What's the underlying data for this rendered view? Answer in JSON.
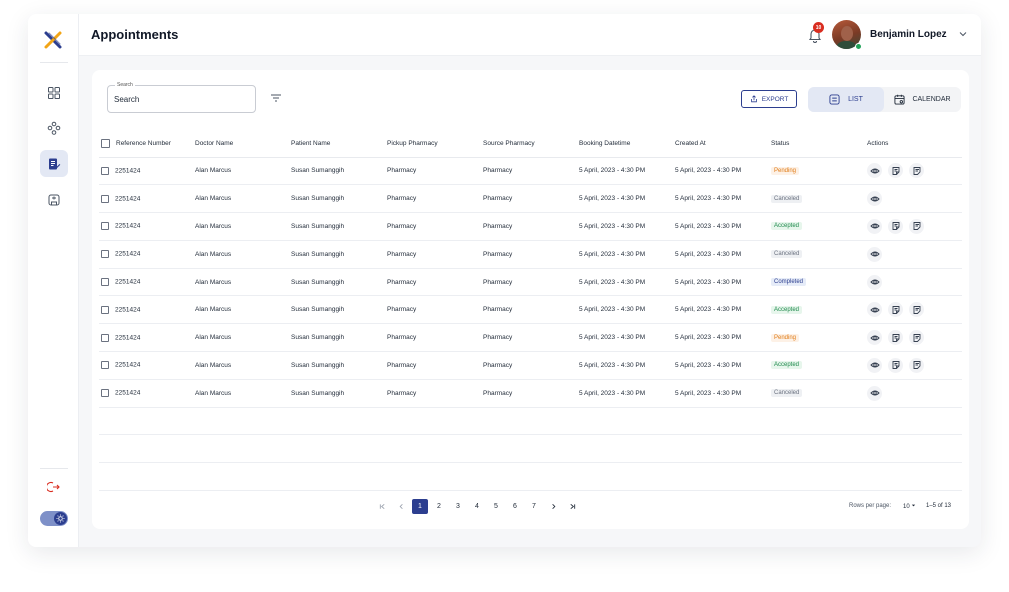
{
  "header": {
    "title": "Appointments",
    "notification_count": "10",
    "user_name": "Benjamin Lopez"
  },
  "sidebar": {
    "items": [
      {
        "icon": "dashboard-grid-icon",
        "active": false
      },
      {
        "icon": "network-nodes-icon",
        "active": false
      },
      {
        "icon": "appointments-edit-icon",
        "active": true
      },
      {
        "icon": "clinic-store-icon",
        "active": false
      }
    ],
    "bottom": [
      {
        "icon": "logout-icon"
      },
      {
        "icon": "theme-toggle-sun-icon"
      }
    ]
  },
  "toolbar": {
    "search_label": "Search",
    "search_value": "Search",
    "export_label": "EXPORT",
    "list_label": "LIST",
    "calendar_label": "CALENDAR"
  },
  "table": {
    "columns": [
      "Reference Number",
      "Doctor Name",
      "Patient Name",
      "Pickup Pharmacy",
      "Source Pharmacy",
      "Booking Datetime",
      "Created At",
      "Status",
      "Actions"
    ],
    "rows": [
      {
        "ref": "2251424",
        "doctor": "Alan Marcus",
        "patient": "Susan Sumanggih",
        "pickup": "Pharmacy",
        "source": "Pharmacy",
        "booking": "5 April, 2023 - 4:30  PM",
        "created": "5 April, 2023 - 4:30  PM",
        "status": "Pending",
        "status_key": "pending",
        "actions": 3
      },
      {
        "ref": "2251424",
        "doctor": "Alan Marcus",
        "patient": "Susan Sumanggih",
        "pickup": "Pharmacy",
        "source": "Pharmacy",
        "booking": "5 April, 2023 - 4:30  PM",
        "created": "5 April, 2023 - 4:30  PM",
        "status": "Canceled",
        "status_key": "canceled",
        "actions": 1
      },
      {
        "ref": "2251424",
        "doctor": "Alan Marcus",
        "patient": "Susan Sumanggih",
        "pickup": "Pharmacy",
        "source": "Pharmacy",
        "booking": "5 April, 2023 - 4:30  PM",
        "created": "5 April, 2023 - 4:30  PM",
        "status": "Accepted",
        "status_key": "accepted",
        "actions": 3
      },
      {
        "ref": "2251424",
        "doctor": "Alan Marcus",
        "patient": "Susan Sumanggih",
        "pickup": "Pharmacy",
        "source": "Pharmacy",
        "booking": "5 April, 2023 - 4:30  PM",
        "created": "5 April, 2023 - 4:30  PM",
        "status": "Canceled",
        "status_key": "canceled",
        "actions": 1
      },
      {
        "ref": "2251424",
        "doctor": "Alan Marcus",
        "patient": "Susan Sumanggih",
        "pickup": "Pharmacy",
        "source": "Pharmacy",
        "booking": "5 April, 2023 - 4:30  PM",
        "created": "5 April, 2023 - 4:30  PM",
        "status": "Completed",
        "status_key": "completed",
        "actions": 1
      },
      {
        "ref": "2251424",
        "doctor": "Alan Marcus",
        "patient": "Susan Sumanggih",
        "pickup": "Pharmacy",
        "source": "Pharmacy",
        "booking": "5 April, 2023 - 4:30  PM",
        "created": "5 April, 2023 - 4:30  PM",
        "status": "Accepted",
        "status_key": "accepted",
        "actions": 3
      },
      {
        "ref": "2251424",
        "doctor": "Alan Marcus",
        "patient": "Susan Sumanggih",
        "pickup": "Pharmacy",
        "source": "Pharmacy",
        "booking": "5 April, 2023 - 4:30  PM",
        "created": "5 April, 2023 - 4:30  PM",
        "status": "Pending",
        "status_key": "pending",
        "actions": 3
      },
      {
        "ref": "2251424",
        "doctor": "Alan Marcus",
        "patient": "Susan Sumanggih",
        "pickup": "Pharmacy",
        "source": "Pharmacy",
        "booking": "5 April, 2023 - 4:30  PM",
        "created": "5 April, 2023 - 4:30  PM",
        "status": "Accepted",
        "status_key": "accepted",
        "actions": 3
      },
      {
        "ref": "2251424",
        "doctor": "Alan Marcus",
        "patient": "Susan Sumanggih",
        "pickup": "Pharmacy",
        "source": "Pharmacy",
        "booking": "5 April, 2023 - 4:30  PM",
        "created": "5 April, 2023 - 4:30  PM",
        "status": "Canceled",
        "status_key": "canceled",
        "actions": 1
      }
    ],
    "empty_rows": 3
  },
  "pagination": {
    "pages": [
      "1",
      "2",
      "3",
      "4",
      "5",
      "6",
      "7"
    ],
    "current": "1",
    "rows_per_page_label": "Rows per page:",
    "rows_per_page_value": "10",
    "range": "1–5 of 13"
  },
  "colors": {
    "primary": "#2c3e8f",
    "pending": "#e07b15",
    "accepted": "#1f8a4c",
    "canceled": "#6b7280",
    "danger": "#d92d20"
  }
}
